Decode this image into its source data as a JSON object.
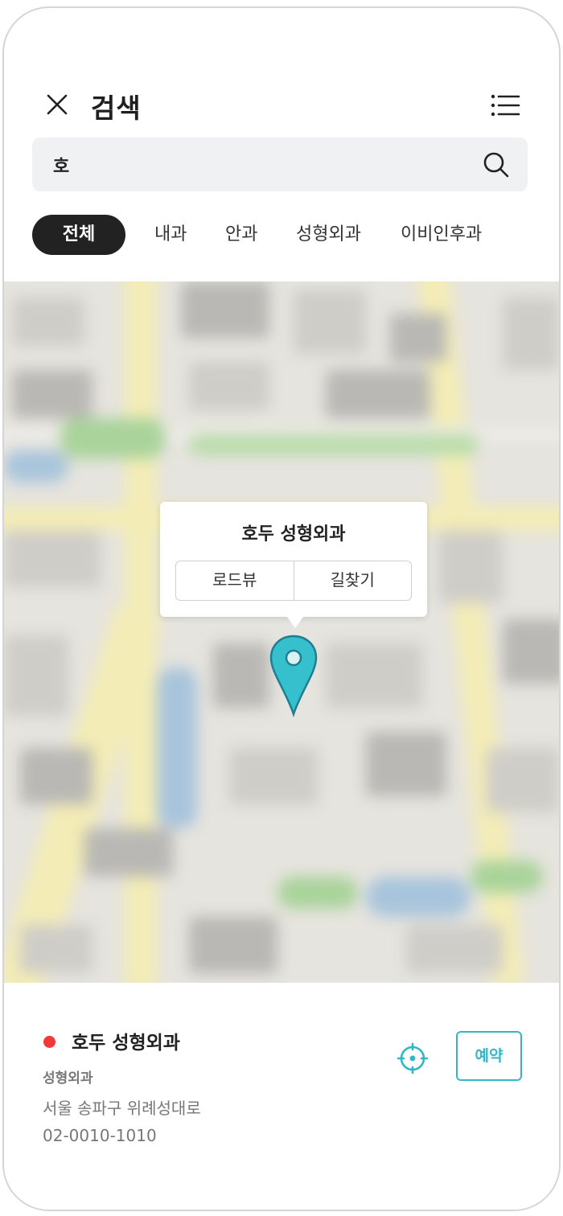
{
  "header": {
    "title": "검색"
  },
  "search": {
    "value": "호"
  },
  "tabs": [
    {
      "label": "전체",
      "active": true
    },
    {
      "label": "내과"
    },
    {
      "label": "안과"
    },
    {
      "label": "성형외과"
    },
    {
      "label": "이비인후과"
    }
  ],
  "map_popup": {
    "title": "호두 성형외과",
    "road_view": "로드뷰",
    "directions": "길찾기"
  },
  "result": {
    "name": "호두 성형외과",
    "category": "성형외과",
    "address": "서울 송파구 위례성대로",
    "phone": "02-0010-1010",
    "reserve_label": "예약",
    "status_color": "#f0393a"
  },
  "colors": {
    "accent": "#33b7c6",
    "tab_active_bg": "#222222",
    "search_bg": "#f0f1f3"
  },
  "icons": [
    "close-icon",
    "list-menu-icon",
    "search-icon",
    "map-pin-icon",
    "locate-icon"
  ]
}
